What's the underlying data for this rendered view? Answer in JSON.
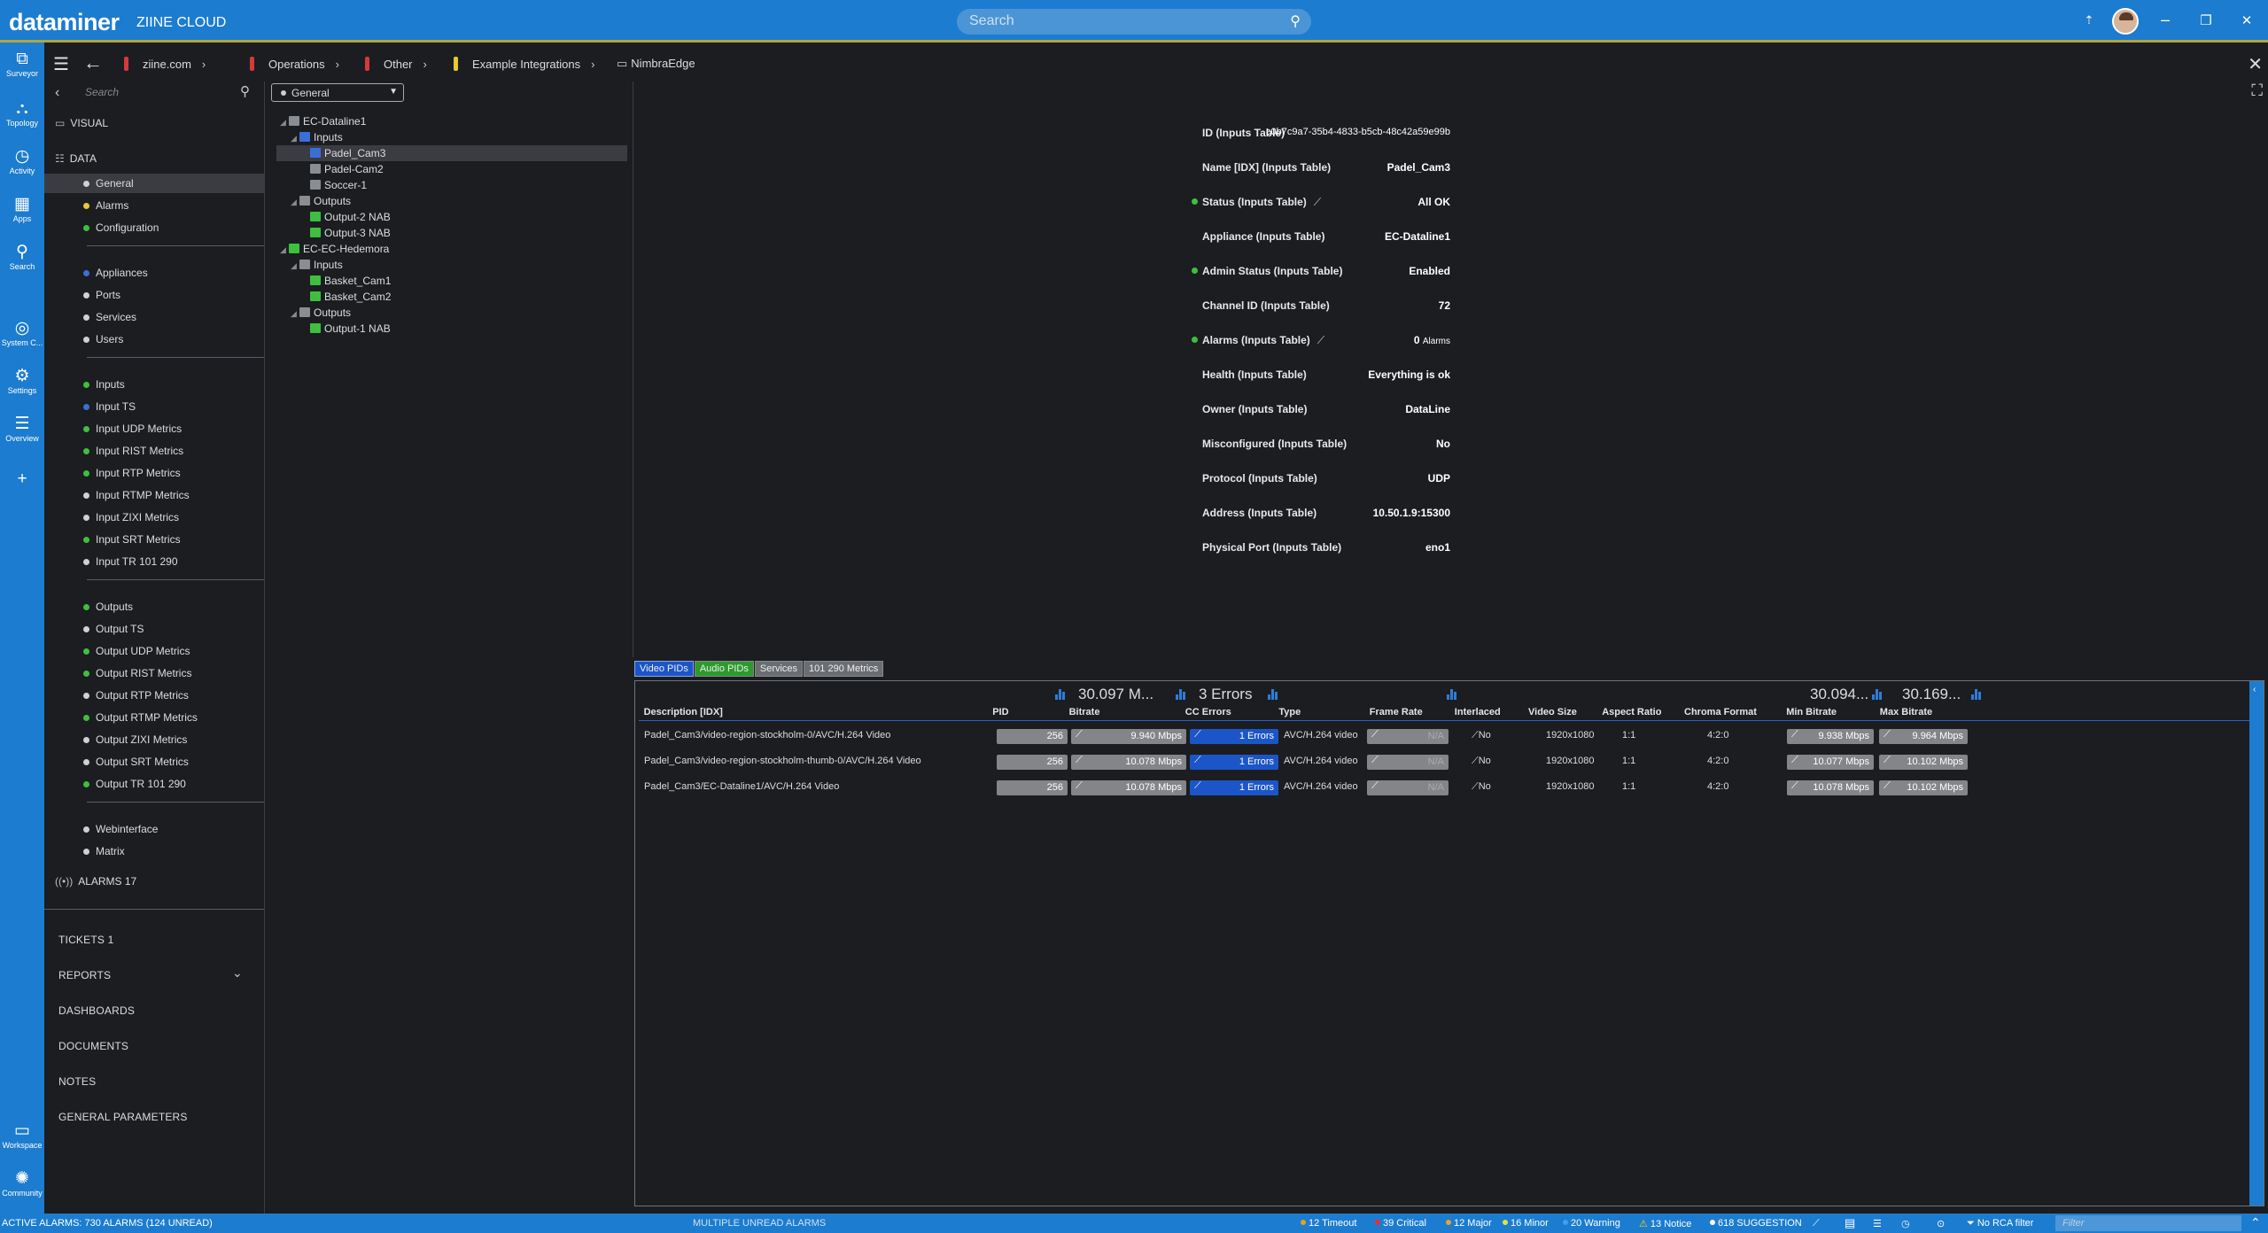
{
  "app": {
    "brand": "dataminer",
    "brand_sub": "ZIINE CLOUD",
    "search_placeholder": "Search",
    "window_controls": [
      "⇡",
      "–",
      "❐",
      "✕"
    ]
  },
  "rail": [
    {
      "label": "Surveyor",
      "icon": "surveyor-icon"
    },
    {
      "label": "Topology",
      "icon": "topology-icon"
    },
    {
      "label": "Activity",
      "icon": "activity-icon"
    },
    {
      "label": "Apps",
      "icon": "apps-icon"
    },
    {
      "label": "Search",
      "icon": "search-icon"
    },
    {
      "label": "System C...",
      "icon": "globe-icon"
    },
    {
      "label": "Settings",
      "icon": "gear-icon"
    },
    {
      "label": "Overview",
      "icon": "overview-icon"
    },
    {
      "label": "",
      "icon": "plus-icon"
    },
    {
      "label": "Workspace",
      "icon": "workspace-icon"
    },
    {
      "label": "Community",
      "icon": "community-icon"
    }
  ],
  "breadcrumbs": [
    {
      "label": "ziine.com",
      "color": "#d43a3a"
    },
    {
      "label": "Operations",
      "color": "#d43a3a"
    },
    {
      "label": "Other",
      "color": "#d43a3a"
    },
    {
      "label": "Example Integrations",
      "color": "#e8c832"
    },
    {
      "label": "NimbraEdge",
      "color": ""
    }
  ],
  "nav": {
    "search_placeholder": "Search",
    "visual_label": "VISUAL",
    "data_label": "DATA",
    "groups": [
      [
        {
          "label": "General",
          "color": "#d0d0d0",
          "selected": true
        },
        {
          "label": "Alarms",
          "color": "#e8c832"
        },
        {
          "label": "Configuration",
          "color": "#3fbf3f"
        }
      ],
      [
        {
          "label": "Appliances",
          "color": "#3a6fd8"
        },
        {
          "label": "Ports",
          "color": "#d0d0d0"
        },
        {
          "label": "Services",
          "color": "#d0d0d0"
        },
        {
          "label": "Users",
          "color": "#d0d0d0"
        }
      ],
      [
        {
          "label": "Inputs",
          "color": "#3fbf3f"
        },
        {
          "label": "Input TS",
          "color": "#3a6fd8"
        },
        {
          "label": "Input UDP Metrics",
          "color": "#3fbf3f"
        },
        {
          "label": "Input RIST Metrics",
          "color": "#3fbf3f"
        },
        {
          "label": "Input RTP Metrics",
          "color": "#3fbf3f"
        },
        {
          "label": "Input RTMP Metrics",
          "color": "#d0d0d0"
        },
        {
          "label": "Input ZIXI Metrics",
          "color": "#d0d0d0"
        },
        {
          "label": "Input SRT Metrics",
          "color": "#3fbf3f"
        },
        {
          "label": "Input TR 101 290",
          "color": "#d0d0d0"
        }
      ],
      [
        {
          "label": "Outputs",
          "color": "#3fbf3f"
        },
        {
          "label": "Output TS",
          "color": "#d0d0d0"
        },
        {
          "label": "Output UDP Metrics",
          "color": "#3fbf3f"
        },
        {
          "label": "Output RIST Metrics",
          "color": "#3fbf3f"
        },
        {
          "label": "Output RTP Metrics",
          "color": "#d0d0d0"
        },
        {
          "label": "Output RTMP Metrics",
          "color": "#3fbf3f"
        },
        {
          "label": "Output ZIXI Metrics",
          "color": "#d0d0d0"
        },
        {
          "label": "Output SRT Metrics",
          "color": "#d0d0d0"
        },
        {
          "label": "Output TR 101 290",
          "color": "#3fbf3f"
        }
      ],
      [
        {
          "label": "Webinterface",
          "color": "#d0d0d0"
        },
        {
          "label": "Matrix",
          "color": "#d0d0d0"
        }
      ]
    ],
    "alarms_label": "ALARMS 17",
    "links": [
      "TICKETS 1",
      "REPORTS",
      "DASHBOARDS",
      "DOCUMENTS",
      "NOTES",
      "GENERAL PARAMETERS"
    ]
  },
  "tree": {
    "page_select": "General",
    "rows": [
      {
        "label": "EC-Dataline1",
        "level": 0,
        "icon": "grey",
        "twist": "◢"
      },
      {
        "label": "Inputs",
        "level": 1,
        "icon": "blue",
        "twist": "◢"
      },
      {
        "label": "Padel_Cam3",
        "level": 2,
        "icon": "blue",
        "selected": true
      },
      {
        "label": "Padel-Cam2",
        "level": 2,
        "icon": "grey"
      },
      {
        "label": "Soccer-1",
        "level": 2,
        "icon": "grey"
      },
      {
        "label": "Outputs",
        "level": 1,
        "icon": "grey",
        "twist": "◢"
      },
      {
        "label": "Output-2 NAB",
        "level": 2,
        "icon": "green"
      },
      {
        "label": "Output-3 NAB",
        "level": 2,
        "icon": "green"
      },
      {
        "label": "EC-EC-Hedemora",
        "level": 0,
        "icon": "green",
        "twist": "◢"
      },
      {
        "label": "Inputs",
        "level": 1,
        "icon": "grey",
        "twist": "◢"
      },
      {
        "label": "Basket_Cam1",
        "level": 2,
        "icon": "green"
      },
      {
        "label": "Basket_Cam2",
        "level": 2,
        "icon": "green"
      },
      {
        "label": "Outputs",
        "level": 1,
        "icon": "grey",
        "twist": "◢"
      },
      {
        "label": "Output-1 NAB",
        "level": 2,
        "icon": "green"
      }
    ]
  },
  "properties": [
    {
      "label": "ID (Inputs Table)",
      "value": "c0b7c9a7-35b4-4833-b5cb-48c42a59e99b",
      "thin": true
    },
    {
      "label": "Name [IDX] (Inputs Table)",
      "value": "Padel_Cam3"
    },
    {
      "label": "Status (Inputs Table)",
      "value": "All OK",
      "dot": true,
      "trend": true
    },
    {
      "label": "Appliance (Inputs Table)",
      "value": "EC-Dataline1"
    },
    {
      "label": "Admin Status (Inputs Table)",
      "value": "Enabled",
      "dot": true
    },
    {
      "label": "Channel ID (Inputs Table)",
      "value": "72"
    },
    {
      "label": "Alarms (Inputs Table)",
      "value": "0",
      "unit": "Alarms",
      "dot": true,
      "trend": true
    },
    {
      "label": "Health (Inputs Table)",
      "value": "Everything is ok"
    },
    {
      "label": "Owner (Inputs Table)",
      "value": "DataLine"
    },
    {
      "label": "Misconfigured (Inputs Table)",
      "value": "No"
    },
    {
      "label": "Protocol (Inputs Table)",
      "value": "UDP"
    },
    {
      "label": "Address (Inputs Table)",
      "value": "10.50.1.9:15300"
    },
    {
      "label": "Physical Port (Inputs Table)",
      "value": "eno1"
    }
  ],
  "table": {
    "tabs": [
      {
        "label": "Video PIDs",
        "style": "active"
      },
      {
        "label": "Audio PIDs",
        "style": "green"
      },
      {
        "label": "Services",
        "style": "grey"
      },
      {
        "label": "101 290 Metrics",
        "style": "grey"
      }
    ],
    "summaries": {
      "bitrate": "30.097 M...",
      "cc": "3 Errors",
      "min": "30.094...",
      "max": "30.169..."
    },
    "columns": [
      "Description [IDX]",
      "PID",
      "Bitrate",
      "CC Errors",
      "Type",
      "Frame Rate",
      "Interlaced",
      "Video Size",
      "Aspect Ratio",
      "Chroma Format",
      "Min Bitrate",
      "Max Bitrate"
    ],
    "rows": [
      {
        "desc": "Padel_Cam3/video-region-stockholm-0/AVC/H.264 Video",
        "pid": "256",
        "bitrate": "9.940 Mbps",
        "cc": "1 Errors",
        "type": "AVC/H.264 video",
        "fps": "N/A",
        "interlaced": "No",
        "size": "1920x1080",
        "aspect": "1:1",
        "chroma": "4:2:0",
        "min": "9.938 Mbps",
        "max": "9.964 Mbps"
      },
      {
        "desc": "Padel_Cam3/video-region-stockholm-thumb-0/AVC/H.264 Video",
        "pid": "256",
        "bitrate": "10.078 Mbps",
        "cc": "1 Errors",
        "type": "AVC/H.264 video",
        "fps": "N/A",
        "interlaced": "No",
        "size": "1920x1080",
        "aspect": "1:1",
        "chroma": "4:2:0",
        "min": "10.077 Mbps",
        "max": "10.102 Mbps"
      },
      {
        "desc": "Padel_Cam3/EC-Dataline1/AVC/H.264 Video",
        "pid": "256",
        "bitrate": "10.078 Mbps",
        "cc": "1 Errors",
        "type": "AVC/H.264 video",
        "fps": "N/A",
        "interlaced": "No",
        "size": "1920x1080",
        "aspect": "1:1",
        "chroma": "4:2:0",
        "min": "10.078 Mbps",
        "max": "10.102 Mbps"
      }
    ]
  },
  "status": {
    "active_alarms": "ACTIVE ALARMS: 730 ALARMS (124 UNREAD)",
    "unread": "MULTIPLE UNREAD ALARMS",
    "counts": [
      {
        "label": "12 Timeout",
        "color": "#e8a020"
      },
      {
        "label": "39 Critical",
        "color": "#e83030"
      },
      {
        "label": "12 Major",
        "color": "#f0a030"
      },
      {
        "label": "16 Minor",
        "color": "#e8e040"
      },
      {
        "label": "20 Warning",
        "color": "#40a0f0"
      },
      {
        "label": "13 Notice",
        "color": "#ffd000",
        "triangle": true
      },
      {
        "label": "618 SUGGESTION",
        "color": "#ffffff"
      }
    ],
    "rca": "No RCA filter",
    "filter_placeholder": "Filter"
  }
}
